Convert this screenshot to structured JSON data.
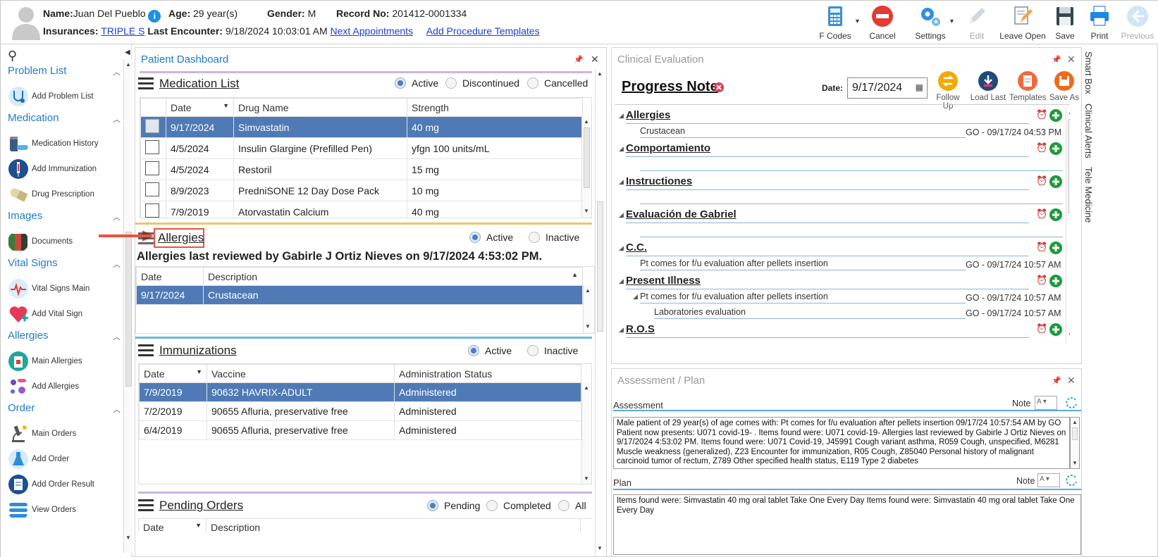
{
  "patient": {
    "name_label": "Name:",
    "name": "Juan Del Pueblo",
    "age_label": "Age:",
    "age": "29 year(s)",
    "gender_label": "Gender:",
    "gender": "M",
    "record_label": "Record No:",
    "record": "201412-0001334",
    "insurances_label": "Insurances:",
    "insurance": "TRIPLE S",
    "last_encounter_label": "Last Encounter:",
    "last_encounter": "9/18/2024 10:03:01 AM",
    "next_appointments": "Next Appointments",
    "add_procedure_templates": "Add Procedure Templates"
  },
  "toolbar": {
    "fcodes": "F Codes",
    "cancel": "Cancel",
    "settings": "Settings",
    "edit": "Edit",
    "leave_open": "Leave Open",
    "save": "Save",
    "print": "Print",
    "previous": "Previous"
  },
  "sidebar": {
    "sections": [
      {
        "title": "Problem List",
        "items": [
          "Add Problem List"
        ]
      },
      {
        "title": "Medication",
        "items": [
          "Medication History",
          "Add Immunization",
          "Drug Prescription"
        ]
      },
      {
        "title": "Images",
        "items": [
          "Documents"
        ]
      },
      {
        "title": "Vital Signs",
        "items": [
          "Vital Signs Main",
          "Add Vital Sign"
        ]
      },
      {
        "title": "Allergies",
        "items": [
          "Main Allergies",
          "Add Allergies"
        ]
      },
      {
        "title": "Order",
        "items": [
          "Main Orders",
          "Add Order",
          "Add Order Result",
          "View Orders"
        ]
      }
    ]
  },
  "dashboard": {
    "title": "Patient Dashboard",
    "medication": {
      "title": "Medication List",
      "filters": [
        "Active",
        "Discontinued",
        "Cancelled"
      ],
      "columns": [
        "Date",
        "Drug Name",
        "Strength"
      ],
      "rows": [
        {
          "date": "9/17/2024",
          "drug": "Simvastatin",
          "strength": "40 mg"
        },
        {
          "date": "4/5/2024",
          "drug": "Insulin Glargine (Prefilled Pen)",
          "strength": "yfgn 100 units/mL"
        },
        {
          "date": "4/5/2024",
          "drug": "Restoril",
          "strength": "15 mg"
        },
        {
          "date": "8/9/2023",
          "drug": "PredniSONE 12 Day Dose Pack",
          "strength": "10 mg"
        },
        {
          "date": "7/9/2019",
          "drug": "Atorvastatin Calcium",
          "strength": "40 mg"
        }
      ]
    },
    "allergies": {
      "title": "Allergies",
      "filters": [
        "Active",
        "Inactive"
      ],
      "reviewed": "Allergies last reviewed by Gabirle J Ortiz Nieves on 9/17/2024 4:53:02 PM.",
      "columns": [
        "Date",
        "Description"
      ],
      "rows": [
        {
          "date": "9/17/2024",
          "description": "Crustacean"
        }
      ]
    },
    "immunizations": {
      "title": "Immunizations",
      "filters": [
        "Active",
        "Inactive"
      ],
      "columns": [
        "Date",
        "Vaccine",
        "Administration Status"
      ],
      "rows": [
        {
          "date": "7/9/2019",
          "vaccine": "90632 HAVRIX-ADULT",
          "status": "Administered"
        },
        {
          "date": "7/2/2019",
          "vaccine": "90655 Afluria, preservative free",
          "status": "Administered"
        },
        {
          "date": "6/4/2019",
          "vaccine": "90655 Afluria, preservative free",
          "status": "Administered"
        }
      ]
    },
    "pending_orders": {
      "title": "Pending Orders",
      "filters": [
        "Pending",
        "Completed",
        "All"
      ],
      "columns": [
        "Date",
        "Description"
      ]
    }
  },
  "clinical": {
    "title": "Clinical Evaluation",
    "note_title": "Progress Note",
    "date_label": "Date:",
    "date": "9/17/2024",
    "actions": [
      "Follow Up",
      "Load Last",
      "Templates",
      "Save As"
    ],
    "sections": {
      "allergies": "Allergies",
      "allergies_item": "Crustacean",
      "allergies_meta": "GO - 09/17/24 04:53 PM",
      "comportamiento": "Comportamiento",
      "instrucciones": "Instructiones",
      "evaluacion": "Evaluación de Gabriel",
      "cc": "C.C.",
      "cc_item": "Pt comes for f/u evaluation after pellets insertion",
      "cc_meta": "GO - 09/17/24 10:57 AM",
      "present_illness": "Present Illness",
      "pi_item": "Pt comes for f/u evaluation after pellets insertion",
      "pi_meta": "GO - 09/17/24 10:57 AM",
      "pi_sub": "Laboratories evaluation",
      "pi_sub_meta": "GO - 09/17/24 10:57 AM",
      "ros": "R.O.S"
    }
  },
  "assessment_plan": {
    "title": "Assessment / Plan",
    "assessment_label": "Assessment",
    "note_label": "Note",
    "assessment_text": "Male patient of 29 year(s) of age comes with:    Pt comes for f/u evaluation after pellets insertion   09/17/24 10:57:54 AM by GO   Patient now presents:  U071 covid-19- . Items found were:  U071 covid-19-    Allergies last reviewed by Gabirle J Ortiz Nieves on 9/17/2024 4:53:02 PM.     Items found were:  U071 Covid-19, J45991 Cough variant asthma, R059 Cough, unspecified, M6281 Muscle weakness (generalized), Z23 Encounter for immunization, R05 Cough, Z85040 Personal history of malignant carcinoid tumor of rectum, Z789 Other specified health status, E119 Type 2 diabetes",
    "plan_label": "Plan",
    "plan_text": "  Items found were:  Simvastatin 40 mg oral tablet Take One Every Day   Items found were:  Simvastatin 40 mg oral tablet Take One Every Day"
  },
  "side_tabs": [
    "Smart Box",
    "Clinical Alerts",
    "Tele Medicine"
  ],
  "colors": {
    "accent": "#1f7bc9",
    "selected_row": "#4f7ab5",
    "link": "#1a3fd6"
  }
}
